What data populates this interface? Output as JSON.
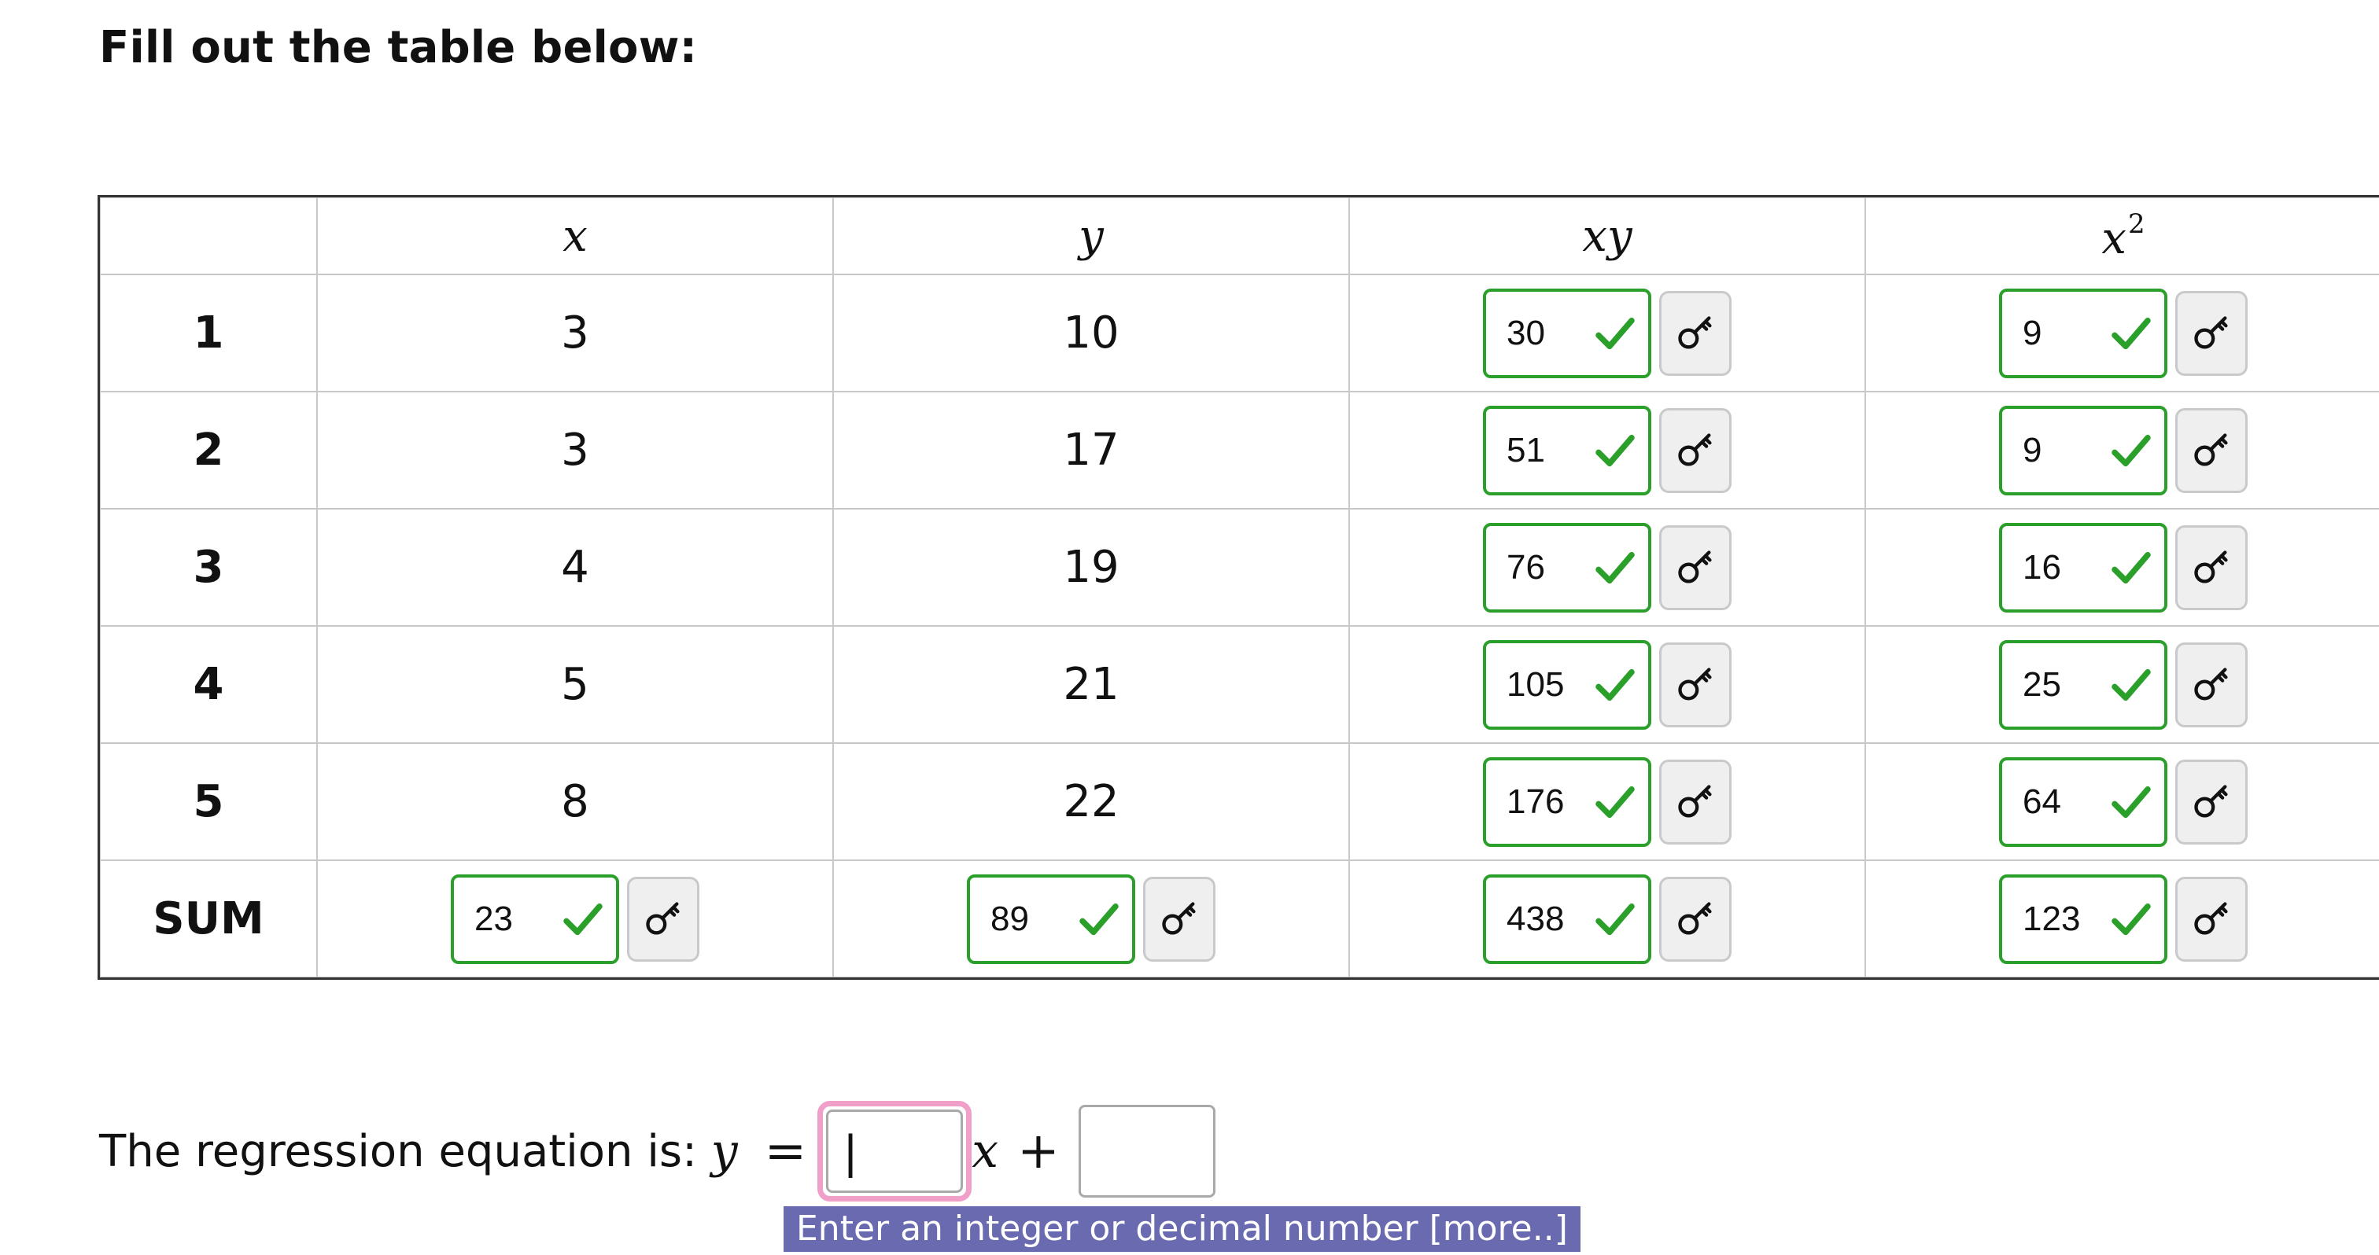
{
  "heading": "Fill out the table below:",
  "table": {
    "headers": [
      "",
      "x",
      "y",
      "xy",
      "x",
      "2"
    ],
    "rows": [
      {
        "label": "1",
        "x": "3",
        "y": "10",
        "xy": "30",
        "x2": "9"
      },
      {
        "label": "2",
        "x": "3",
        "y": "17",
        "xy": "51",
        "x2": "9"
      },
      {
        "label": "3",
        "x": "4",
        "y": "19",
        "xy": "76",
        "x2": "16"
      },
      {
        "label": "4",
        "x": "5",
        "y": "21",
        "xy": "105",
        "x2": "25"
      },
      {
        "label": "5",
        "x": "8",
        "y": "22",
        "xy": "176",
        "x2": "64"
      }
    ],
    "sum": {
      "label": "SUM",
      "x": "23",
      "y": "89",
      "xy": "438",
      "x2": "123"
    }
  },
  "equation": {
    "prefix": "The regression equation is: ",
    "y": "y",
    "equals": "=",
    "slope_value": "",
    "x": "x",
    "plus": "+",
    "intercept_value": ""
  },
  "tooltip": {
    "text": "Enter an integer or decimal number ",
    "more": "[more..]"
  },
  "colors": {
    "correct": "#2aa02a",
    "focus": "#f0a0c8",
    "tooltip_bg": "#6a6ab0"
  },
  "icons": {
    "check": "check-icon",
    "key": "key-icon"
  }
}
